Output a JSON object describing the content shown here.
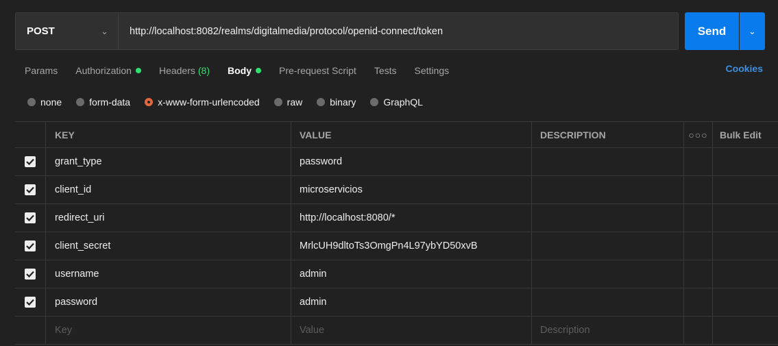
{
  "request": {
    "method": "POST",
    "url": "http://localhost:8082/realms/digitalmedia/protocol/openid-connect/token",
    "send_label": "Send"
  },
  "tabs": [
    {
      "label": "Params"
    },
    {
      "label": "Authorization",
      "dot": true
    },
    {
      "label": "Headers",
      "count": "(8)"
    },
    {
      "label": "Body",
      "dot": true,
      "active": true
    },
    {
      "label": "Pre-request Script"
    },
    {
      "label": "Tests"
    },
    {
      "label": "Settings"
    }
  ],
  "cookies_label": "Cookies",
  "body_types": [
    {
      "label": "none"
    },
    {
      "label": "form-data"
    },
    {
      "label": "x-www-form-urlencoded",
      "selected": true
    },
    {
      "label": "raw"
    },
    {
      "label": "binary"
    },
    {
      "label": "GraphQL"
    }
  ],
  "table": {
    "headers": {
      "key": "KEY",
      "value": "VALUE",
      "description": "DESCRIPTION",
      "bulk_edit": "Bulk Edit"
    },
    "rows": [
      {
        "key": "grant_type",
        "value": "password",
        "checked": true
      },
      {
        "key": "client_id",
        "value": "microservicios",
        "checked": true
      },
      {
        "key": "redirect_uri",
        "value": "http://localhost:8080/*",
        "checked": true
      },
      {
        "key": "client_secret",
        "value": "MrlcUH9dltoTs3OmgPn4L97ybYD50xvB",
        "checked": true
      },
      {
        "key": "username",
        "value": "admin",
        "checked": true
      },
      {
        "key": "password",
        "value": "admin",
        "checked": true
      }
    ],
    "placeholders": {
      "key": "Key",
      "value": "Value",
      "description": "Description"
    }
  },
  "colors": {
    "accent_blue": "#097bed",
    "status_green": "#2ee06f",
    "selected_orange": "#e06a3d"
  }
}
